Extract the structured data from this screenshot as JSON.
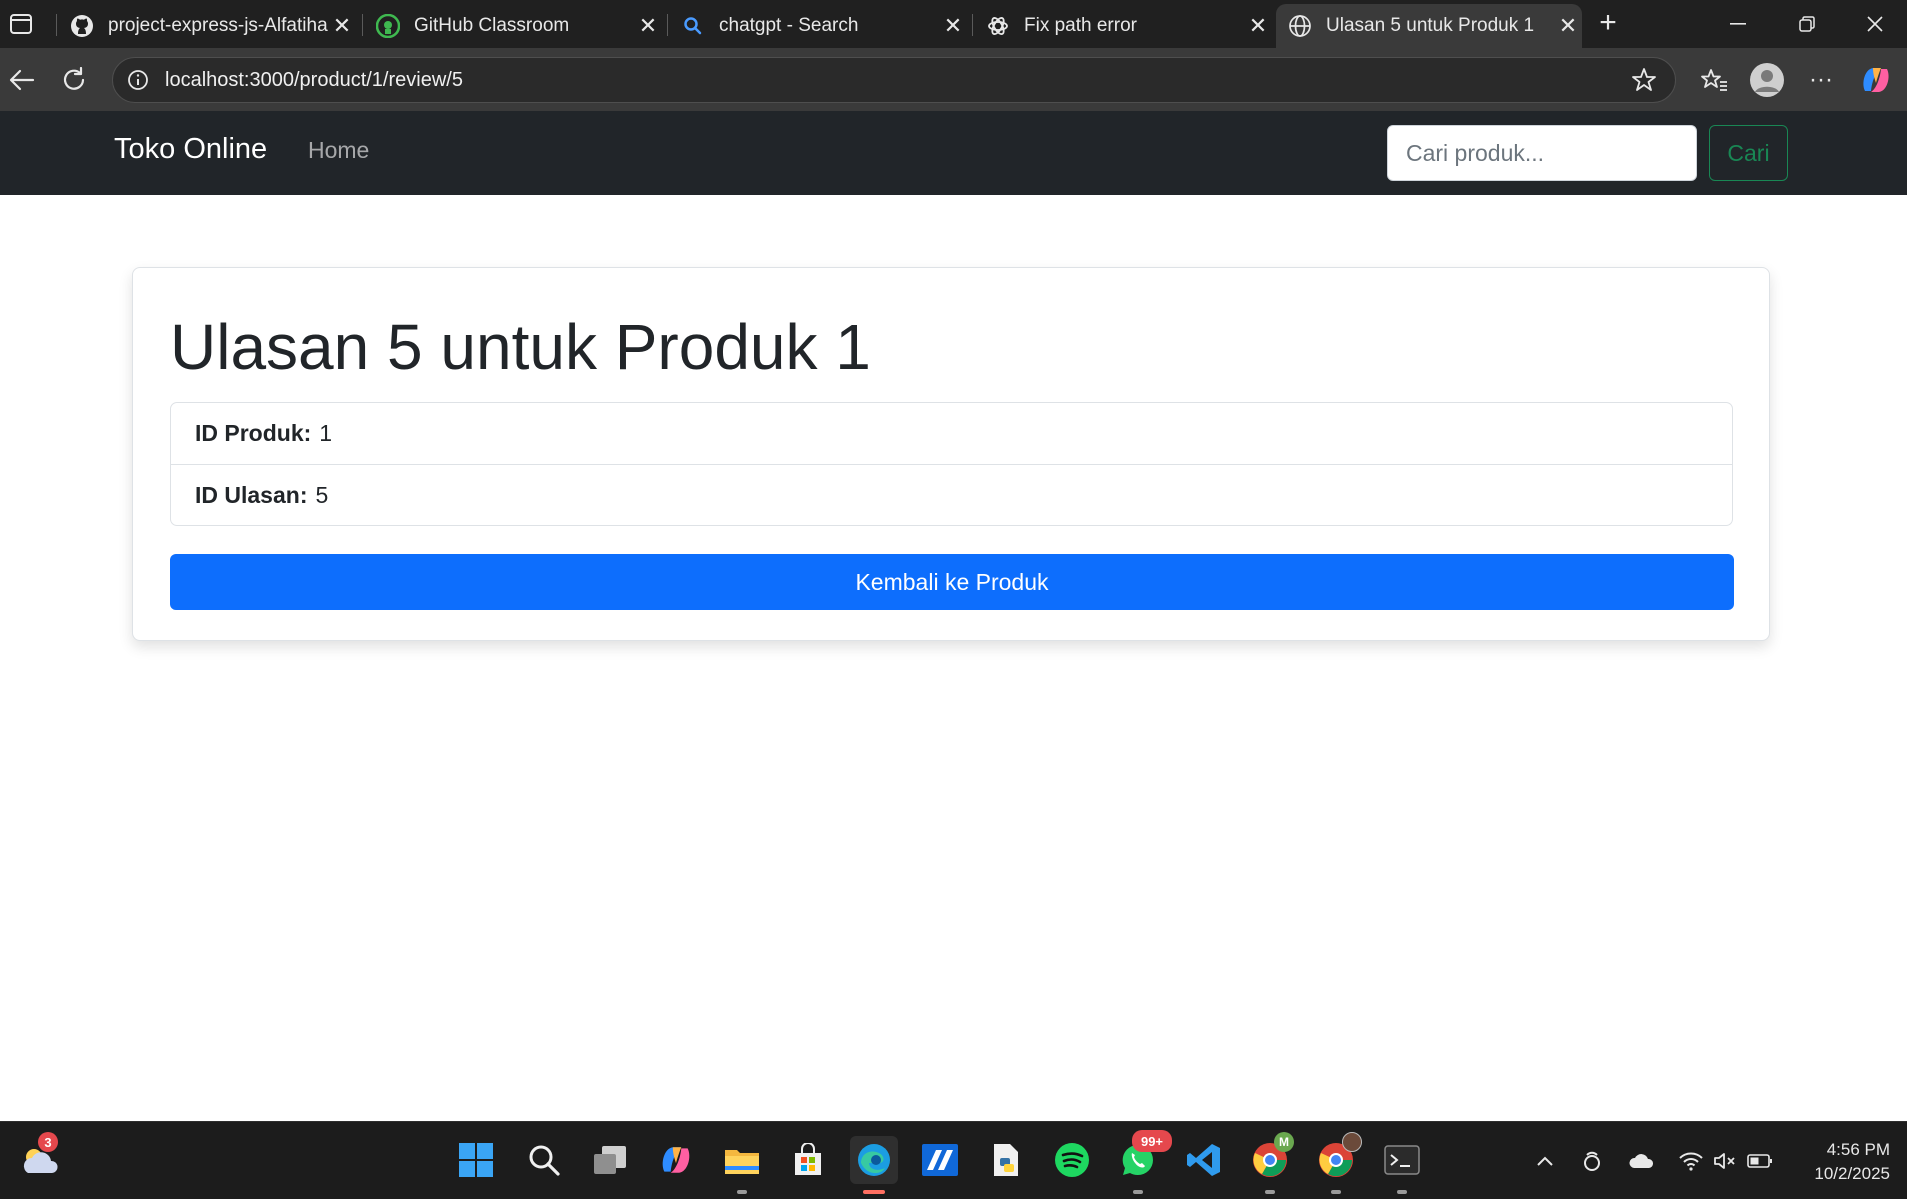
{
  "browser": {
    "tabs": [
      {
        "title": "project-express-js-Alfatihah",
        "icon": "github-icon"
      },
      {
        "title": "GitHub Classroom",
        "icon": "github-classroom-icon"
      },
      {
        "title": "chatgpt - Search",
        "icon": "search-icon"
      },
      {
        "title": "Fix path error",
        "icon": "chatgpt-icon"
      },
      {
        "title": "Ulasan 5 untuk Produk 1",
        "icon": "globe-icon",
        "active": true
      }
    ],
    "url": "localhost:3000/product/1/review/5"
  },
  "navbar": {
    "brand": "Toko Online",
    "home": "Home",
    "search_placeholder": "Cari produk...",
    "search_button": "Cari"
  },
  "review": {
    "heading": "Ulasan 5 untuk Produk 1",
    "details": [
      {
        "label": "ID Produk:",
        "value": "1"
      },
      {
        "label": "ID Ulasan:",
        "value": "5"
      }
    ],
    "back_button": "Kembali ke Produk"
  },
  "taskbar": {
    "weather_badge": "3",
    "whatsapp_badge": "99+",
    "chrome_profile_letter": "M",
    "time": "4:56 PM",
    "date": "10/2/2025"
  },
  "colors": {
    "navbar_bg": "#212529",
    "primary": "#0d6efd",
    "success": "#198754"
  }
}
